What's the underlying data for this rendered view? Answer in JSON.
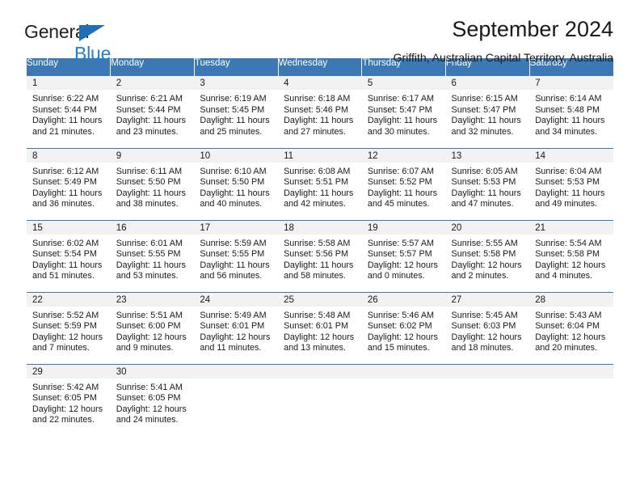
{
  "brand": {
    "line1": "General",
    "line2": "Blue",
    "triangle_color": "#1f6fb4",
    "text_color": "#231f20",
    "accent_color": "#1f7fd0"
  },
  "header": {
    "title": "September 2024",
    "subtitle": "Griffith, Australian Capital Territory, Australia"
  },
  "colors": {
    "header_bg": "#3b78b4",
    "daynum_bg": "#f2f2f2",
    "row_divider": "#3b78b4"
  },
  "weekday_headers": [
    "Sunday",
    "Monday",
    "Tuesday",
    "Wednesday",
    "Thursday",
    "Friday",
    "Saturday"
  ],
  "labels": {
    "sunrise_prefix": "Sunrise:",
    "sunset_prefix": "Sunset:",
    "daylight_prefix": "Daylight:"
  },
  "weeks": [
    [
      {
        "day": "1",
        "sunrise": "Sunrise: 6:22 AM",
        "sunset": "Sunset: 5:44 PM",
        "daylight": "Daylight: 11 hours and 21 minutes."
      },
      {
        "day": "2",
        "sunrise": "Sunrise: 6:21 AM",
        "sunset": "Sunset: 5:44 PM",
        "daylight": "Daylight: 11 hours and 23 minutes."
      },
      {
        "day": "3",
        "sunrise": "Sunrise: 6:19 AM",
        "sunset": "Sunset: 5:45 PM",
        "daylight": "Daylight: 11 hours and 25 minutes."
      },
      {
        "day": "4",
        "sunrise": "Sunrise: 6:18 AM",
        "sunset": "Sunset: 5:46 PM",
        "daylight": "Daylight: 11 hours and 27 minutes."
      },
      {
        "day": "5",
        "sunrise": "Sunrise: 6:17 AM",
        "sunset": "Sunset: 5:47 PM",
        "daylight": "Daylight: 11 hours and 30 minutes."
      },
      {
        "day": "6",
        "sunrise": "Sunrise: 6:15 AM",
        "sunset": "Sunset: 5:47 PM",
        "daylight": "Daylight: 11 hours and 32 minutes."
      },
      {
        "day": "7",
        "sunrise": "Sunrise: 6:14 AM",
        "sunset": "Sunset: 5:48 PM",
        "daylight": "Daylight: 11 hours and 34 minutes."
      }
    ],
    [
      {
        "day": "8",
        "sunrise": "Sunrise: 6:12 AM",
        "sunset": "Sunset: 5:49 PM",
        "daylight": "Daylight: 11 hours and 36 minutes."
      },
      {
        "day": "9",
        "sunrise": "Sunrise: 6:11 AM",
        "sunset": "Sunset: 5:50 PM",
        "daylight": "Daylight: 11 hours and 38 minutes."
      },
      {
        "day": "10",
        "sunrise": "Sunrise: 6:10 AM",
        "sunset": "Sunset: 5:50 PM",
        "daylight": "Daylight: 11 hours and 40 minutes."
      },
      {
        "day": "11",
        "sunrise": "Sunrise: 6:08 AM",
        "sunset": "Sunset: 5:51 PM",
        "daylight": "Daylight: 11 hours and 42 minutes."
      },
      {
        "day": "12",
        "sunrise": "Sunrise: 6:07 AM",
        "sunset": "Sunset: 5:52 PM",
        "daylight": "Daylight: 11 hours and 45 minutes."
      },
      {
        "day": "13",
        "sunrise": "Sunrise: 6:05 AM",
        "sunset": "Sunset: 5:53 PM",
        "daylight": "Daylight: 11 hours and 47 minutes."
      },
      {
        "day": "14",
        "sunrise": "Sunrise: 6:04 AM",
        "sunset": "Sunset: 5:53 PM",
        "daylight": "Daylight: 11 hours and 49 minutes."
      }
    ],
    [
      {
        "day": "15",
        "sunrise": "Sunrise: 6:02 AM",
        "sunset": "Sunset: 5:54 PM",
        "daylight": "Daylight: 11 hours and 51 minutes."
      },
      {
        "day": "16",
        "sunrise": "Sunrise: 6:01 AM",
        "sunset": "Sunset: 5:55 PM",
        "daylight": "Daylight: 11 hours and 53 minutes."
      },
      {
        "day": "17",
        "sunrise": "Sunrise: 5:59 AM",
        "sunset": "Sunset: 5:55 PM",
        "daylight": "Daylight: 11 hours and 56 minutes."
      },
      {
        "day": "18",
        "sunrise": "Sunrise: 5:58 AM",
        "sunset": "Sunset: 5:56 PM",
        "daylight": "Daylight: 11 hours and 58 minutes."
      },
      {
        "day": "19",
        "sunrise": "Sunrise: 5:57 AM",
        "sunset": "Sunset: 5:57 PM",
        "daylight": "Daylight: 12 hours and 0 minutes."
      },
      {
        "day": "20",
        "sunrise": "Sunrise: 5:55 AM",
        "sunset": "Sunset: 5:58 PM",
        "daylight": "Daylight: 12 hours and 2 minutes."
      },
      {
        "day": "21",
        "sunrise": "Sunrise: 5:54 AM",
        "sunset": "Sunset: 5:58 PM",
        "daylight": "Daylight: 12 hours and 4 minutes."
      }
    ],
    [
      {
        "day": "22",
        "sunrise": "Sunrise: 5:52 AM",
        "sunset": "Sunset: 5:59 PM",
        "daylight": "Daylight: 12 hours and 7 minutes."
      },
      {
        "day": "23",
        "sunrise": "Sunrise: 5:51 AM",
        "sunset": "Sunset: 6:00 PM",
        "daylight": "Daylight: 12 hours and 9 minutes."
      },
      {
        "day": "24",
        "sunrise": "Sunrise: 5:49 AM",
        "sunset": "Sunset: 6:01 PM",
        "daylight": "Daylight: 12 hours and 11 minutes."
      },
      {
        "day": "25",
        "sunrise": "Sunrise: 5:48 AM",
        "sunset": "Sunset: 6:01 PM",
        "daylight": "Daylight: 12 hours and 13 minutes."
      },
      {
        "day": "26",
        "sunrise": "Sunrise: 5:46 AM",
        "sunset": "Sunset: 6:02 PM",
        "daylight": "Daylight: 12 hours and 15 minutes."
      },
      {
        "day": "27",
        "sunrise": "Sunrise: 5:45 AM",
        "sunset": "Sunset: 6:03 PM",
        "daylight": "Daylight: 12 hours and 18 minutes."
      },
      {
        "day": "28",
        "sunrise": "Sunrise: 5:43 AM",
        "sunset": "Sunset: 6:04 PM",
        "daylight": "Daylight: 12 hours and 20 minutes."
      }
    ],
    [
      {
        "day": "29",
        "sunrise": "Sunrise: 5:42 AM",
        "sunset": "Sunset: 6:05 PM",
        "daylight": "Daylight: 12 hours and 22 minutes."
      },
      {
        "day": "30",
        "sunrise": "Sunrise: 5:41 AM",
        "sunset": "Sunset: 6:05 PM",
        "daylight": "Daylight: 12 hours and 24 minutes."
      },
      {
        "day": "",
        "sunrise": "",
        "sunset": "",
        "daylight": ""
      },
      {
        "day": "",
        "sunrise": "",
        "sunset": "",
        "daylight": ""
      },
      {
        "day": "",
        "sunrise": "",
        "sunset": "",
        "daylight": ""
      },
      {
        "day": "",
        "sunrise": "",
        "sunset": "",
        "daylight": ""
      },
      {
        "day": "",
        "sunrise": "",
        "sunset": "",
        "daylight": ""
      }
    ]
  ]
}
